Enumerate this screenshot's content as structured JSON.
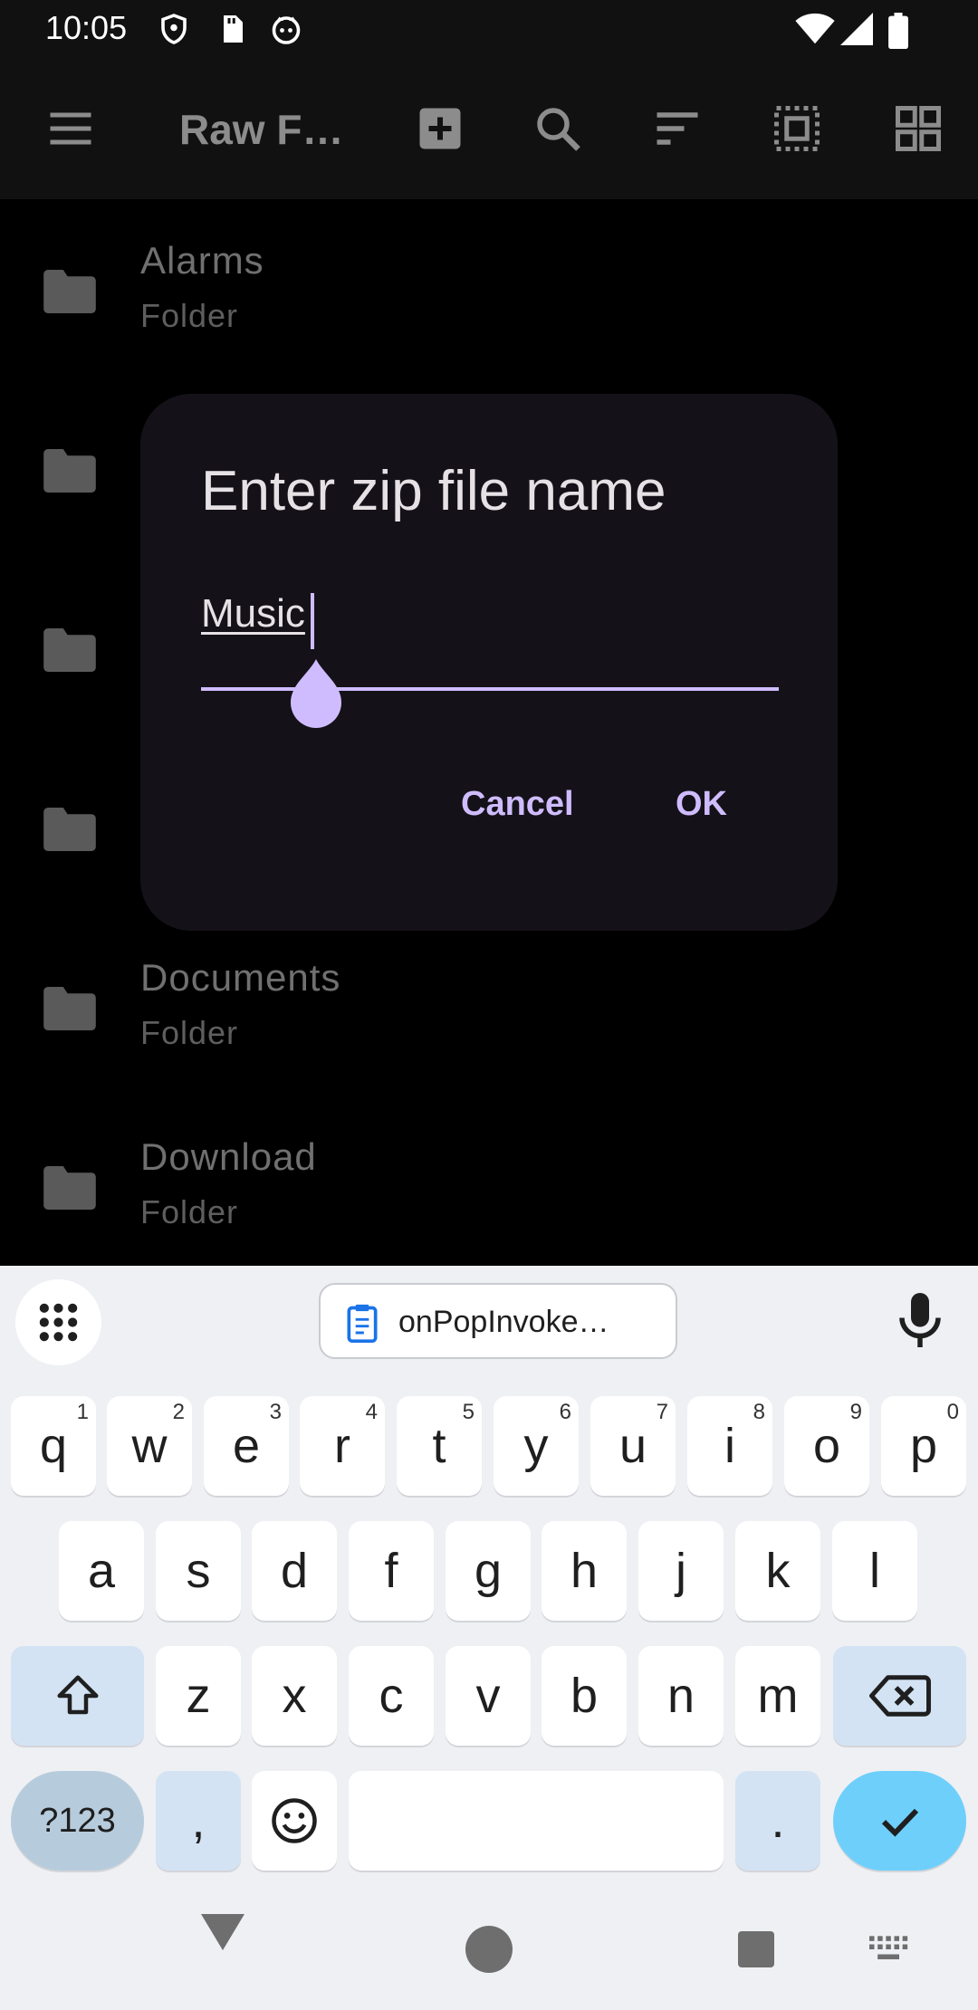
{
  "status_bar": {
    "time": "10:05"
  },
  "app_bar": {
    "title": "Raw F…"
  },
  "files": [
    {
      "name": "Alarms",
      "type": "Folder"
    },
    {
      "name": "Documents",
      "type": "Folder"
    },
    {
      "name": "Download",
      "type": "Folder"
    }
  ],
  "dialog": {
    "title": "Enter zip file name",
    "input_value": "Music",
    "cancel_label": "Cancel",
    "ok_label": "OK"
  },
  "keyboard": {
    "clipboard_suggestion": "onPopInvoke…",
    "row1": [
      {
        "key": "q",
        "hint": "1"
      },
      {
        "key": "w",
        "hint": "2"
      },
      {
        "key": "e",
        "hint": "3"
      },
      {
        "key": "r",
        "hint": "4"
      },
      {
        "key": "t",
        "hint": "5"
      },
      {
        "key": "y",
        "hint": "6"
      },
      {
        "key": "u",
        "hint": "7"
      },
      {
        "key": "i",
        "hint": "8"
      },
      {
        "key": "o",
        "hint": "9"
      },
      {
        "key": "p",
        "hint": "0"
      }
    ],
    "row2": [
      "a",
      "s",
      "d",
      "f",
      "g",
      "h",
      "j",
      "k",
      "l"
    ],
    "row3": [
      "z",
      "x",
      "c",
      "v",
      "b",
      "n",
      "m"
    ],
    "symbols_label": "?123",
    "comma": ",",
    "period": "."
  },
  "colors": {
    "accent": "#cfbcff",
    "dialog_bg": "#141218",
    "enter_key": "#6ecffb",
    "modifier_key": "#d3e3f3"
  },
  "icons": [
    "menu-icon",
    "add-box-icon",
    "search-icon",
    "sort-icon",
    "select-all-icon",
    "grid-view-icon",
    "folder-icon",
    "mic-icon",
    "clipboard-icon",
    "emoji-icon",
    "shift-icon",
    "backspace-icon",
    "check-icon"
  ]
}
